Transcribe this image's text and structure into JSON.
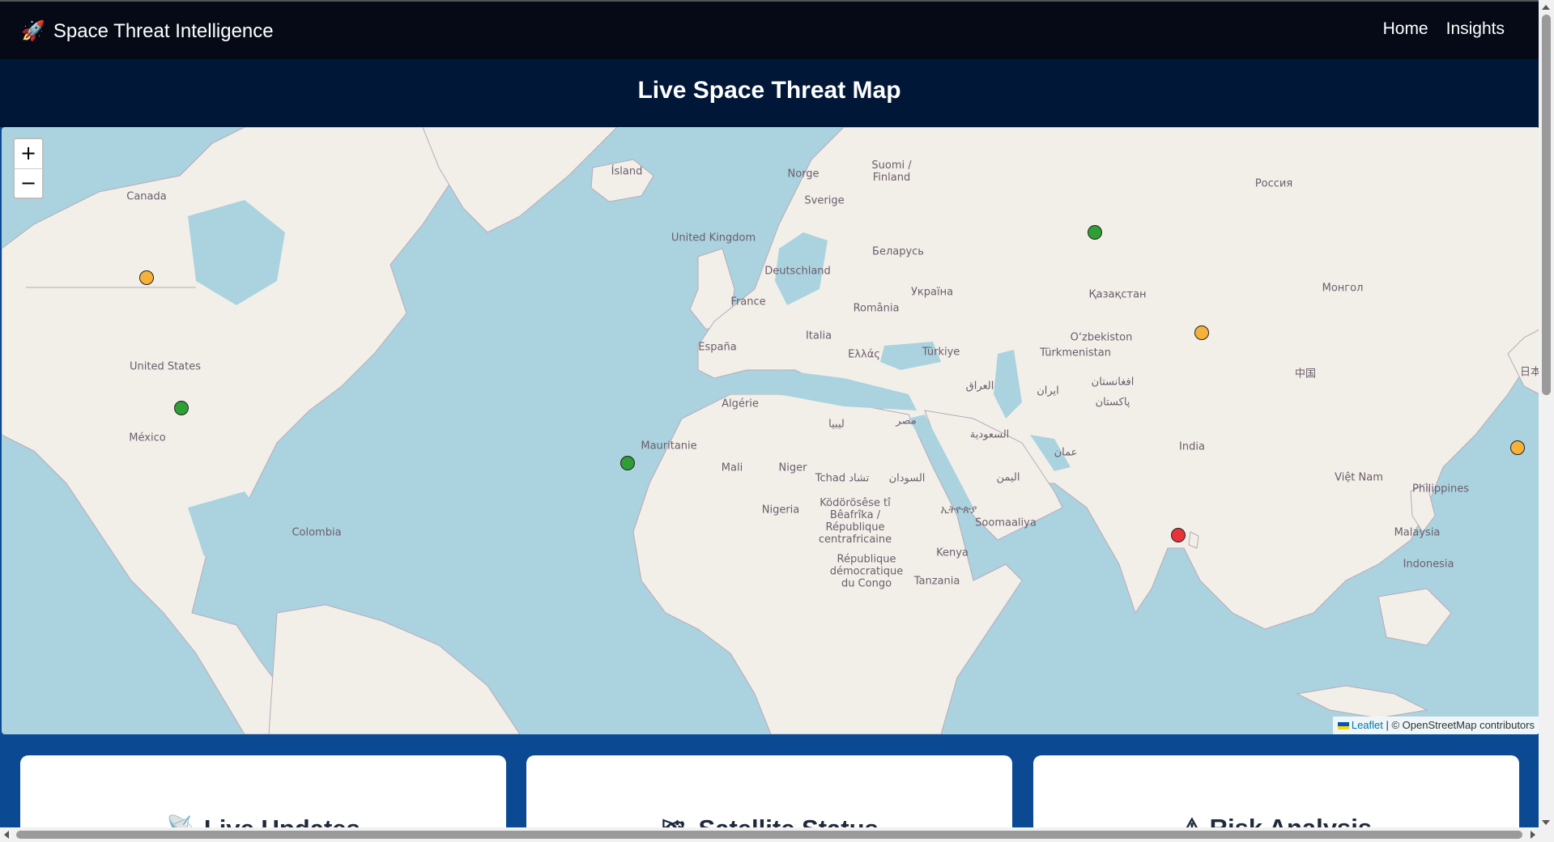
{
  "navbar": {
    "brand_icon": "rocket-icon",
    "brand": "Space Threat Intelligence",
    "links": [
      "Home",
      "Insights"
    ]
  },
  "page_title": "Live Space Threat Map",
  "map": {
    "zoom_in": "+",
    "zoom_out": "−",
    "attribution": {
      "leaflet": "Leaflet",
      "rest": " | © OpenStreetMap contributors"
    },
    "colors": {
      "water": "#aad3df",
      "land": "#f2efe9",
      "green": "#2e9e35",
      "orange": "#f6b13a",
      "red": "#e8323a"
    },
    "labels": {
      "canada": "Canada",
      "united_states": "United States",
      "mexico": "México",
      "colombia": "Colombia",
      "island": "Ísland",
      "norge": "Norge",
      "sverige": "Sverige",
      "suomi": "Suomi / Finland",
      "united_kingdom": "United Kingdom",
      "deutschland": "Deutschland",
      "france": "France",
      "espana": "España",
      "italia": "Italia",
      "romania": "România",
      "belarus": "Беларусь",
      "ukraina": "Україна",
      "ellas": "Ελλάς",
      "turkiye": "Türkiye",
      "rossiya": "Россия",
      "kazakhstan": "Қазақстан",
      "uzbekistan": "O‘zbekiston",
      "turkmenistan": "Türkmenistan",
      "mongol": "Монгол",
      "china": "中国",
      "iraq": "العراق",
      "iran": "ایران",
      "afghanistan": "افغانستان",
      "pakistan": "پاکستان",
      "india": "India",
      "saudi": "السعودية",
      "oman": "عمان",
      "yemen": "اليمن",
      "algerie": "Algérie",
      "libya": "ليبيا",
      "misr": "مصر",
      "mauritanie": "Mauritanie",
      "mali": "Mali",
      "niger": "Niger",
      "tchad": "Tchad تشاد",
      "sudan": "السودان",
      "nigeria": "Nigeria",
      "car": "Ködörösêse tî Bêafrîka / République centrafricaine",
      "ethiopia": "ኢትዮጵያ",
      "somalia": "Soomaaliya",
      "kenya": "Kenya",
      "drc": "République démocratique du Congo",
      "tanzania": "Tanzania",
      "vietnam": "Việt Nam",
      "philippines": "Philippines",
      "malaysia": "Malaysia",
      "indonesia": "Indonesia",
      "japan": "日本"
    }
  },
  "cards": [
    {
      "icon": "satellite-antenna-icon",
      "icon_glyph": "📡",
      "title": "Live Updates"
    },
    {
      "icon": "satellite-icon",
      "icon_glyph": "🛰",
      "title": "Satellite Status"
    },
    {
      "icon": "warning-icon",
      "icon_glyph": "⚠",
      "title": "Risk Analysis"
    }
  ]
}
